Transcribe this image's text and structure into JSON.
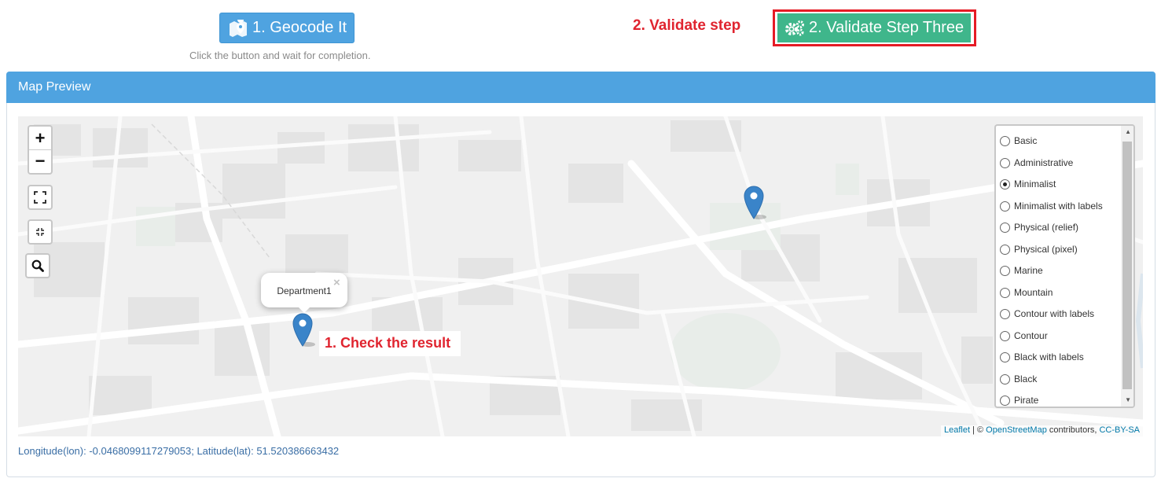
{
  "toolbar": {
    "geocode_label": "1. Geocode It",
    "hint": "Click the button and wait for completion.",
    "validate_annotation": "2. Validate step",
    "validate_label": "2. Validate Step Three"
  },
  "panel": {
    "title": "Map Preview"
  },
  "map": {
    "zoom_in": "+",
    "zoom_out": "−",
    "popup_text": "Department1",
    "popup_close": "×",
    "check_annotation": "1. Check the result",
    "layers": [
      {
        "label": "Basic",
        "checked": false
      },
      {
        "label": "Administrative",
        "checked": false
      },
      {
        "label": "Minimalist",
        "checked": true
      },
      {
        "label": "Minimalist with labels",
        "checked": false
      },
      {
        "label": "Physical (relief)",
        "checked": false
      },
      {
        "label": "Physical (pixel)",
        "checked": false
      },
      {
        "label": "Marine",
        "checked": false
      },
      {
        "label": "Mountain",
        "checked": false
      },
      {
        "label": "Contour with labels",
        "checked": false
      },
      {
        "label": "Contour",
        "checked": false
      },
      {
        "label": "Black with labels",
        "checked": false
      },
      {
        "label": "Black",
        "checked": false
      },
      {
        "label": "Pirate",
        "checked": false
      }
    ],
    "attribution": {
      "leaflet": "Leaflet",
      "sep": " | © ",
      "osm": "OpenStreetMap",
      "contrib": " contributors, ",
      "license": "CC-BY-SA"
    }
  },
  "coordinates": "Longitude(lon): -0.0468099117279053; Latitude(lat): 51.520386663432",
  "colors": {
    "primary": "#4fa3e0",
    "success": "#3fb68b",
    "annotation": "#e0242f",
    "marker": "#3a84c9"
  }
}
